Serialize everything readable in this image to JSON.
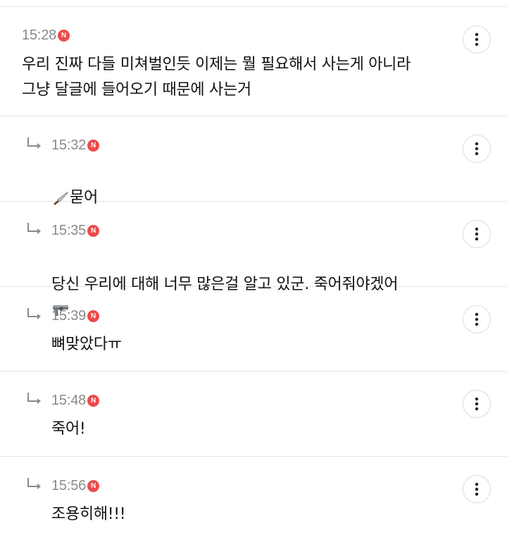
{
  "comments": [
    {
      "time": "15:28",
      "badge": "N",
      "text": "우리 진짜 다들 미쳐벌인듯 이제는 뭘 필요해서 사는게 아니라\n그냥 달글에 들어오기 때문에 사는거"
    },
    {
      "time": "15:32",
      "badge": "N",
      "prefix_icon": "knife-icon",
      "text": "묻어"
    },
    {
      "time": "15:35",
      "badge": "N",
      "text": "당신 우리에 대해 너무 많은걸 알고 있군. 죽어줘야겠어",
      "suffix_icon": "pistol-icon"
    },
    {
      "time": "15:39",
      "badge": "N",
      "text": "뼈맞았다ㅠ"
    },
    {
      "time": "15:48",
      "badge": "N",
      "text": "죽어!"
    },
    {
      "time": "15:56",
      "badge": "N",
      "text": "조용히해!!!"
    }
  ],
  "icons": {
    "reply": "reply-arrow-icon",
    "more": "more-vertical-icon",
    "new_badge": "new-badge-icon"
  },
  "colors": {
    "badge": "#ec4b4b",
    "time": "#8a8a8a",
    "divider": "#e6e6e6"
  }
}
